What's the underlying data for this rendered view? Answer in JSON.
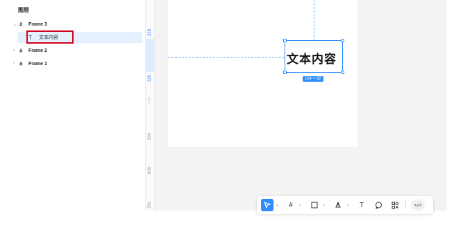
{
  "layers_panel": {
    "title": "图层",
    "items": [
      {
        "label": "Frame 3",
        "expanded": true
      },
      {
        "label": "文本内容",
        "type": "text",
        "selected": true
      },
      {
        "label": "Frame 2",
        "expanded": false
      },
      {
        "label": "Frame 1",
        "expanded": false
      }
    ]
  },
  "canvas": {
    "ruler_ticks": [
      "228",
      "320",
      "400",
      "500",
      "600",
      "700"
    ],
    "selected_text": "文本内容",
    "selection_size": "164 × 92"
  },
  "toolbar": {
    "tools": [
      "move-tool",
      "frame-tool",
      "rectangle-tool",
      "pen-tool",
      "text-tool",
      "comment-tool",
      "assets-tool"
    ],
    "code_label": "</>"
  },
  "colors": {
    "accent": "#2d8cff",
    "highlight": "#e4f0fd",
    "annotation_red": "#d0021b"
  }
}
